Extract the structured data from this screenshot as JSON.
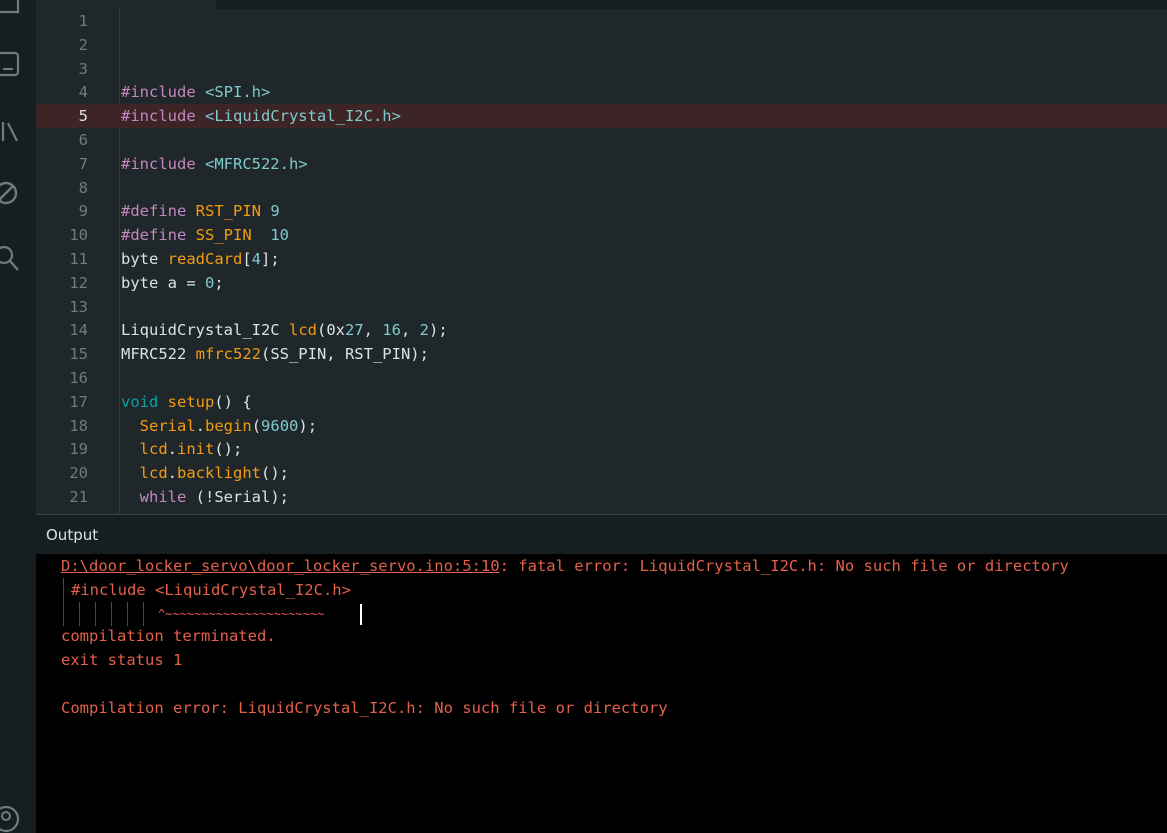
{
  "colors": {
    "editor_bg": "#1f272a",
    "panel_bg": "#171e21",
    "output_bg": "#000000",
    "text": "#dae3e3",
    "line_number": "#6e7b7f",
    "keyword_teal": "#0ca1a6",
    "preprocessor_purple": "#c586c0",
    "function_orange": "#f39c12",
    "number_teal": "#7fcbcd",
    "error_highlight": "#3d2427",
    "error_text": "#e3604b"
  },
  "activity_bar": {
    "icons": [
      "folder-icon",
      "board-icon",
      "library-icon",
      "debug-icon",
      "search-icon",
      "account-icon"
    ]
  },
  "editor": {
    "active_line": "5",
    "lines": [
      {
        "number": "1",
        "tokens": []
      },
      {
        "number": "2",
        "tokens": []
      },
      {
        "number": "3",
        "tokens": []
      },
      {
        "number": "4",
        "tokens": [
          {
            "text": "#include",
            "color": "#c586c0"
          },
          {
            "text": " <SPI.h>",
            "color": "#7fcbcd"
          }
        ]
      },
      {
        "number": "5",
        "tokens": [
          {
            "text": "#include",
            "color": "#c586c0"
          },
          {
            "text": " <LiquidCrystal_I2C.h>",
            "color": "#7fcbcd"
          }
        ]
      },
      {
        "number": "6",
        "tokens": []
      },
      {
        "number": "7",
        "tokens": [
          {
            "text": "#include",
            "color": "#c586c0"
          },
          {
            "text": " <MFRC522.h>",
            "color": "#7fcbcd"
          }
        ]
      },
      {
        "number": "8",
        "tokens": []
      },
      {
        "number": "9",
        "tokens": [
          {
            "text": "#define",
            "color": "#c586c0"
          },
          {
            "text": " ",
            "color": "#dae3e3"
          },
          {
            "text": "RST_PIN",
            "color": "#f39c12"
          },
          {
            "text": " ",
            "color": "#dae3e3"
          },
          {
            "text": "9",
            "color": "#7fcbcd"
          }
        ]
      },
      {
        "number": "10",
        "tokens": [
          {
            "text": "#define",
            "color": "#c586c0"
          },
          {
            "text": " ",
            "color": "#dae3e3"
          },
          {
            "text": "SS_PIN",
            "color": "#f39c12"
          },
          {
            "text": "  ",
            "color": "#dae3e3"
          },
          {
            "text": "10",
            "color": "#7fcbcd"
          }
        ]
      },
      {
        "number": "11",
        "tokens": [
          {
            "text": "byte ",
            "color": "#dae3e3"
          },
          {
            "text": "readCard",
            "color": "#f39c12"
          },
          {
            "text": "[",
            "color": "#dae3e3"
          },
          {
            "text": "4",
            "color": "#7fcbcd"
          },
          {
            "text": "];",
            "color": "#dae3e3"
          }
        ]
      },
      {
        "number": "12",
        "tokens": [
          {
            "text": "byte a = ",
            "color": "#dae3e3"
          },
          {
            "text": "0",
            "color": "#7fcbcd"
          },
          {
            "text": ";",
            "color": "#dae3e3"
          }
        ]
      },
      {
        "number": "13",
        "tokens": []
      },
      {
        "number": "14",
        "tokens": [
          {
            "text": "LiquidCrystal_I2C ",
            "color": "#dae3e3"
          },
          {
            "text": "lcd",
            "color": "#f39c12"
          },
          {
            "text": "(0x",
            "color": "#dae3e3"
          },
          {
            "text": "27",
            "color": "#7fcbcd"
          },
          {
            "text": ", ",
            "color": "#dae3e3"
          },
          {
            "text": "16",
            "color": "#7fcbcd"
          },
          {
            "text": ", ",
            "color": "#dae3e3"
          },
          {
            "text": "2",
            "color": "#7fcbcd"
          },
          {
            "text": ");",
            "color": "#dae3e3"
          }
        ]
      },
      {
        "number": "15",
        "tokens": [
          {
            "text": "MFRC522 ",
            "color": "#dae3e3"
          },
          {
            "text": "mfrc522",
            "color": "#f39c12"
          },
          {
            "text": "(SS_PIN, RST_PIN);",
            "color": "#dae3e3"
          }
        ]
      },
      {
        "number": "16",
        "tokens": []
      },
      {
        "number": "17",
        "tokens": [
          {
            "text": "void",
            "color": "#0ca1a6"
          },
          {
            "text": " ",
            "color": "#dae3e3"
          },
          {
            "text": "setup",
            "color": "#f39c12"
          },
          {
            "text": "() {",
            "color": "#dae3e3"
          }
        ]
      },
      {
        "number": "18",
        "tokens": [
          {
            "text": "  ",
            "color": "#dae3e3"
          },
          {
            "text": "Serial",
            "color": "#f39c12"
          },
          {
            "text": ".",
            "color": "#dae3e3"
          },
          {
            "text": "begin",
            "color": "#f39c12"
          },
          {
            "text": "(",
            "color": "#dae3e3"
          },
          {
            "text": "9600",
            "color": "#7fcbcd"
          },
          {
            "text": ");",
            "color": "#dae3e3"
          }
        ]
      },
      {
        "number": "19",
        "tokens": [
          {
            "text": "  ",
            "color": "#dae3e3"
          },
          {
            "text": "lcd",
            "color": "#f39c12"
          },
          {
            "text": ".",
            "color": "#dae3e3"
          },
          {
            "text": "init",
            "color": "#f39c12"
          },
          {
            "text": "();",
            "color": "#dae3e3"
          }
        ]
      },
      {
        "number": "20",
        "tokens": [
          {
            "text": "  ",
            "color": "#dae3e3"
          },
          {
            "text": "lcd",
            "color": "#f39c12"
          },
          {
            "text": ".",
            "color": "#dae3e3"
          },
          {
            "text": "backlight",
            "color": "#f39c12"
          },
          {
            "text": "();",
            "color": "#dae3e3"
          }
        ]
      },
      {
        "number": "21",
        "tokens": [
          {
            "text": "  ",
            "color": "#dae3e3"
          },
          {
            "text": "while",
            "color": "#c586c0"
          },
          {
            "text": " (!Serial);",
            "color": "#dae3e3"
          }
        ]
      }
    ]
  },
  "output": {
    "title": "Output",
    "error_path": "D:\\door_locker_servo\\door_locker_servo.ino:5:10",
    "error_message": ": fatal error: LiquidCrystal_I2C.h: No such file or directory",
    "include_line": "#include <LiquidCrystal_I2C.h>",
    "caret_line": "^~~~~~~~~~~~~~~~~~~~~~~",
    "terminated": "compilation terminated.",
    "exit_status": "exit status 1",
    "summary": "Compilation error: LiquidCrystal_I2C.h: No such file or directory"
  }
}
